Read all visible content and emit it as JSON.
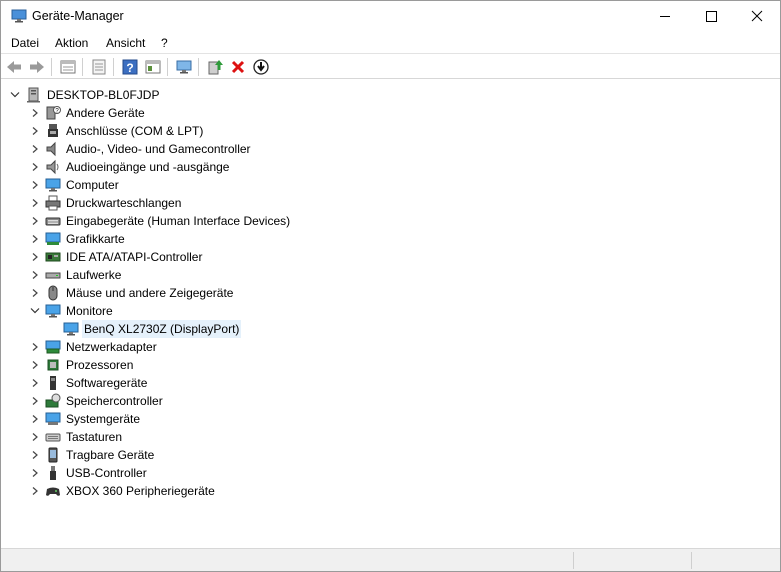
{
  "window": {
    "title": "Geräte-Manager"
  },
  "menu": [
    {
      "label": "Datei"
    },
    {
      "label": "Aktion"
    },
    {
      "label": "Ansicht"
    },
    {
      "label": "?"
    }
  ],
  "toolbar": {
    "buttons": [
      "back-icon",
      "forward-icon",
      "properties-view-icon",
      "properties-icon",
      "help-icon",
      "show-hidden-icon",
      "scan-hardware-icon",
      "update-driver-icon",
      "uninstall-icon",
      "disable-icon"
    ]
  },
  "tree": {
    "root": "DESKTOP-BL0FJDP",
    "categories": [
      {
        "label": "Andere Geräte"
      },
      {
        "label": "Anschlüsse (COM & LPT)"
      },
      {
        "label": "Audio-, Video- und Gamecontroller"
      },
      {
        "label": "Audioeingänge und -ausgänge"
      },
      {
        "label": "Computer"
      },
      {
        "label": "Druckwarteschlangen"
      },
      {
        "label": "Eingabegeräte (Human Interface Devices)"
      },
      {
        "label": "Grafikkarte"
      },
      {
        "label": "IDE ATA/ATAPI-Controller"
      },
      {
        "label": "Laufwerke"
      },
      {
        "label": "Mäuse und andere Zeigegeräte"
      },
      {
        "label": "Monitore"
      },
      {
        "label": "Netzwerkadapter"
      },
      {
        "label": "Prozessoren"
      },
      {
        "label": "Softwaregeräte"
      },
      {
        "label": "Speichercontroller"
      },
      {
        "label": "Systemgeräte"
      },
      {
        "label": "Tastaturen"
      },
      {
        "label": "Tragbare Geräte"
      },
      {
        "label": "USB-Controller"
      },
      {
        "label": "XBOX 360 Peripheriegeräte"
      }
    ],
    "monitor_child": "BenQ XL2730Z (DisplayPort)"
  }
}
